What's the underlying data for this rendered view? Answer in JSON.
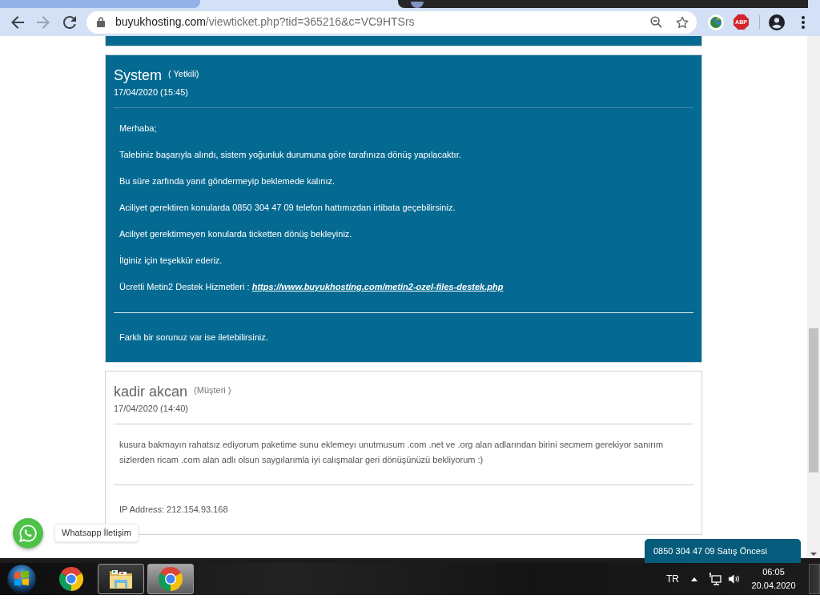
{
  "browser": {
    "nav": [
      {
        "kind": "back",
        "disabled": false
      },
      {
        "kind": "forward",
        "disabled": true
      },
      {
        "kind": "reload",
        "disabled": false
      }
    ],
    "url_host": "buyukhosting.com",
    "url_path": "/viewticket.php?tid=365216&c=VC9HTSrs",
    "extension_badge": "ABP"
  },
  "messages": [
    {
      "kind": "staff",
      "author": "System",
      "role": "( Yetkili)",
      "date": "17/04/2020 (15:45)",
      "paragraphs": [
        {
          "text": "Merhaba;"
        },
        {
          "text": "Talebiniz başarıyla alındı, sistem yoğunluk durumuna göre tarafınıza dönüş yapılacaktır."
        },
        {
          "text": "Bu süre zarfında yanıt göndermeyip beklemede kalınız."
        },
        {
          "text": "Aciliyet gerektiren konularda 0850 304 47 09 telefon hattımızdan irtibata geçebilirsiniz."
        },
        {
          "text": "Aciliyet gerektirmeyen konularda ticketten dönüş bekleyiniz."
        },
        {
          "text": "İlginiz için teşekkür ederiz."
        },
        {
          "text": "Ücretli Metin2 Destek Hizmetleri :",
          "link": "https://www.buyukhosting.com/metin2-ozel-files-destek.php"
        }
      ],
      "footer": "Farklı bir sorunuz var ise iletebilirsiniz."
    },
    {
      "kind": "customer",
      "author": "kadir akcan",
      "role": "(Müşteri )",
      "date": "17/04/2020 (14:40)",
      "paragraphs": [
        {
          "text": "kusura bakmayın rahatsız ediyorum paketime sunu eklemeyı unutmusum .com .net ve .org alan adlarından birini secmem gerekiyor sanırım sizlerden ricam .com alan adlı olsun saygılarımla iyi calışmalar geri dönüşünüzü bekliyorum :)"
        }
      ],
      "footer": "IP Address: 212.154.93.168"
    }
  ],
  "whatsapp": {
    "label": "Whatsapp İletişim"
  },
  "sales_bar": {
    "label": "0850 304 47 09 Satış Öncesi"
  },
  "taskbar": {
    "apps": [
      {
        "kind": "chrome",
        "open": false,
        "selected": false
      },
      {
        "kind": "explorer",
        "open": true,
        "selected": false
      },
      {
        "kind": "chrome",
        "open": true,
        "selected": true
      }
    ],
    "language": "TR",
    "time": "06:05",
    "date": "20.04.2020"
  }
}
